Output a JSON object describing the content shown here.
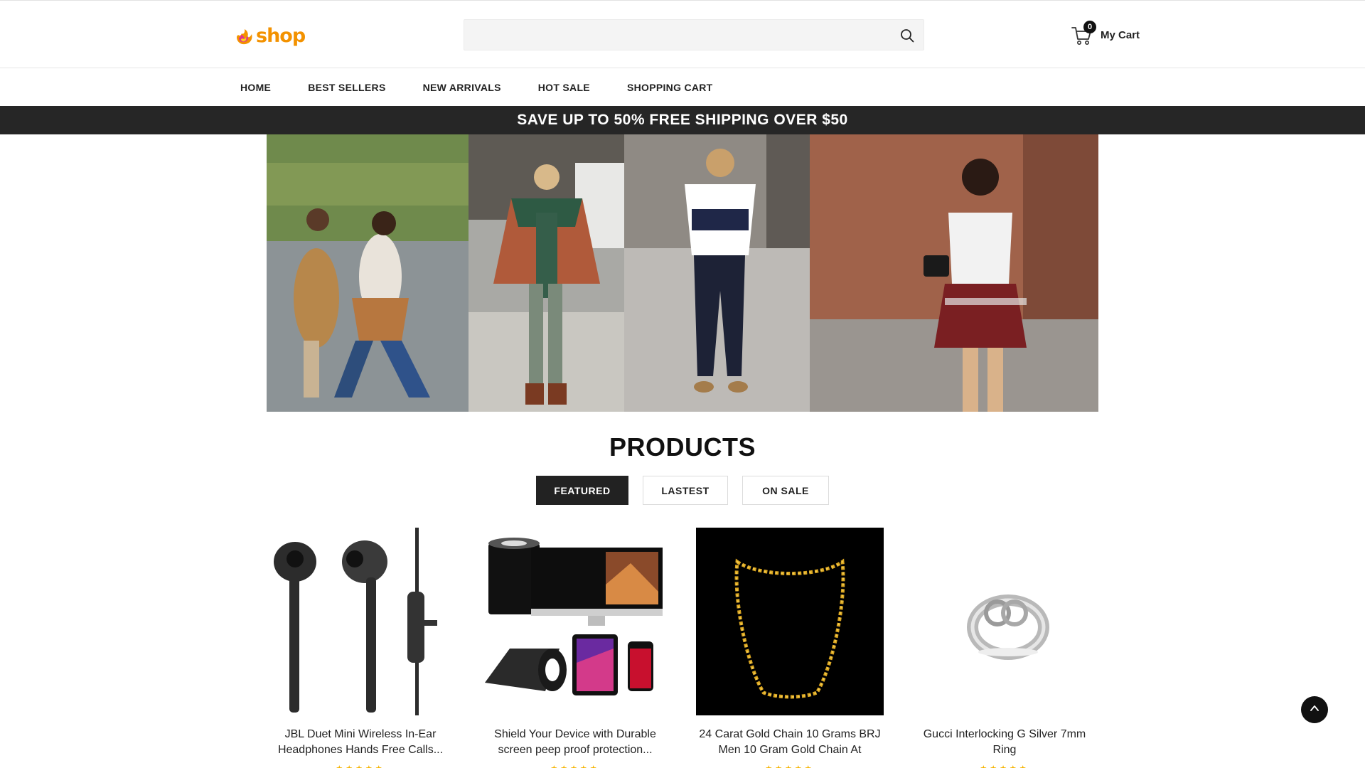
{
  "header": {
    "logo_text": "shop",
    "search": {
      "placeholder": "",
      "value": ""
    },
    "cart": {
      "count": "0",
      "label": "My Cart"
    }
  },
  "nav": {
    "items": [
      {
        "label": "HOME"
      },
      {
        "label": "BEST SELLERS"
      },
      {
        "label": "NEW ARRIVALS"
      },
      {
        "label": "HOT SALE"
      },
      {
        "label": "SHOPPING CART"
      }
    ]
  },
  "promo": {
    "text": "SAVE UP TO 50% FREE SHIPPING OVER $50"
  },
  "products": {
    "title": "PRODUCTS",
    "tabs": [
      {
        "label": "FEATURED",
        "active": true
      },
      {
        "label": "LASTEST",
        "active": false
      },
      {
        "label": "ON SALE",
        "active": false
      }
    ],
    "items": [
      {
        "title": "JBL Duet Mini Wireless In-Ear Headphones Hands Free Calls...",
        "rating": "★★★★★",
        "image_icon": "earphones-image"
      },
      {
        "title": "Shield Your Device with Durable screen peep proof protection...",
        "rating": "★★★★★",
        "image_icon": "privacy-film-image"
      },
      {
        "title": "24 Carat Gold Chain 10 Grams BRJ Men 10 Gram Gold Chain At",
        "rating": "★★★★★",
        "image_icon": "gold-chain-image"
      },
      {
        "title": "Gucci Interlocking G Silver 7mm Ring",
        "rating": "★★★★★",
        "image_icon": "silver-ring-image"
      }
    ]
  },
  "colors": {
    "brand": "#f39200",
    "dark": "#262626",
    "star": "#f5b301"
  }
}
